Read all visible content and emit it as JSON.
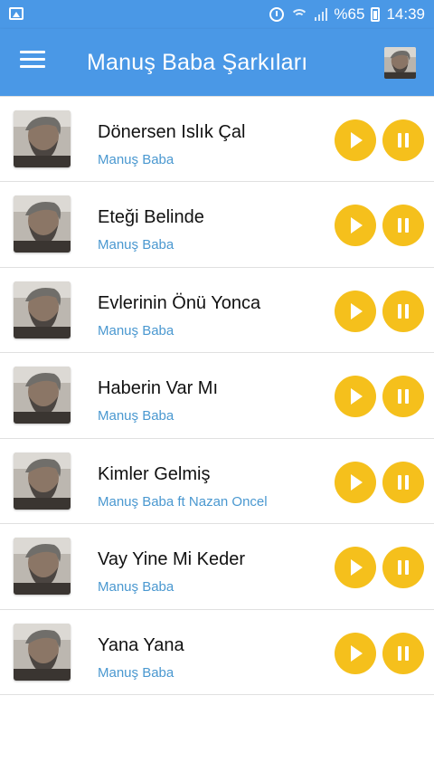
{
  "status_bar": {
    "battery_text": "%65",
    "time": "14:39",
    "icons": [
      "gallery-icon",
      "alarm-icon",
      "wifi-icon",
      "signal-icon",
      "battery-icon"
    ]
  },
  "app_bar": {
    "title": "Manuş Baba Şarkıları",
    "menu_icon": "hamburger-menu-icon",
    "avatar": "artist-avatar"
  },
  "colors": {
    "primary": "#4a98e6",
    "accent": "#f5c01c",
    "artist_text": "#4a98d0"
  },
  "songs": [
    {
      "title": "",
      "artist": ""
    },
    {
      "title": "Dönersen Islık Çal",
      "artist": "Manuş Baba"
    },
    {
      "title": "Eteği Belinde",
      "artist": "Manuş Baba"
    },
    {
      "title": "Evlerinin Önü Yonca",
      "artist": "Manuş Baba"
    },
    {
      "title": "Haberin Var Mı",
      "artist": "Manuş Baba"
    },
    {
      "title": "Kimler Gelmiş",
      "artist": "Manuş Baba ft Nazan Oncel"
    },
    {
      "title": "Vay Yine Mi Keder",
      "artist": "Manuş Baba"
    },
    {
      "title": "Yana Yana",
      "artist": "Manuş Baba"
    }
  ]
}
